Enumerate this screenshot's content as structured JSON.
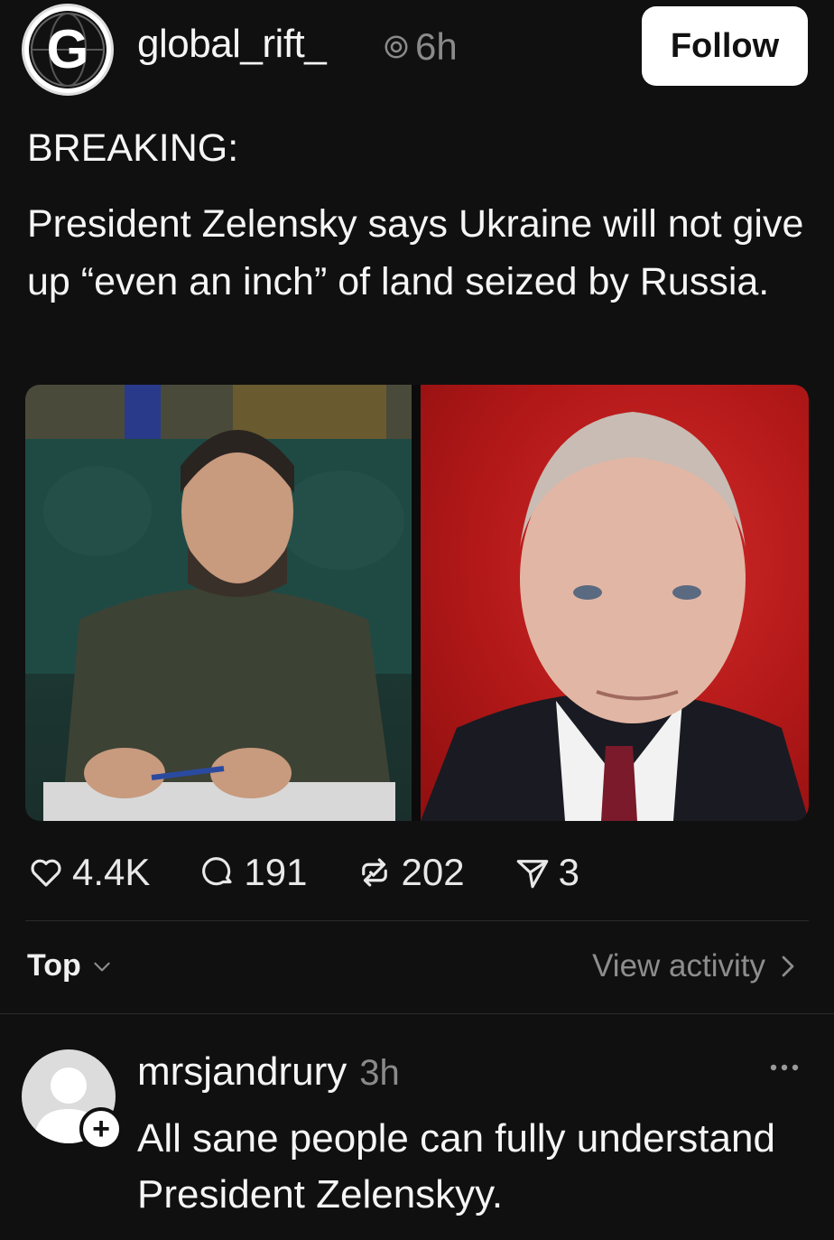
{
  "post": {
    "username": "global_rift_",
    "time": "6h",
    "follow_label": "Follow",
    "avatar_letter": "G",
    "breaking": "BREAKING:",
    "headline": "President Zelensky says Ukraine will not give up “even an inch” of land seized by Russia.",
    "stats": {
      "likes": "4.4K",
      "comments": "191",
      "reposts": "202",
      "shares": "3"
    }
  },
  "sort": {
    "label": "Top"
  },
  "view_activity": {
    "label": "View activity"
  },
  "reply": {
    "username": "mrsjandrury",
    "time": "3h",
    "text": "All sane people can fully understand President Zelenskyy.",
    "plus": "+"
  },
  "colors": {
    "background": "#101010",
    "text": "#f5f5f5",
    "muted": "#8a8a8a",
    "follow_bg": "#ffffff"
  }
}
